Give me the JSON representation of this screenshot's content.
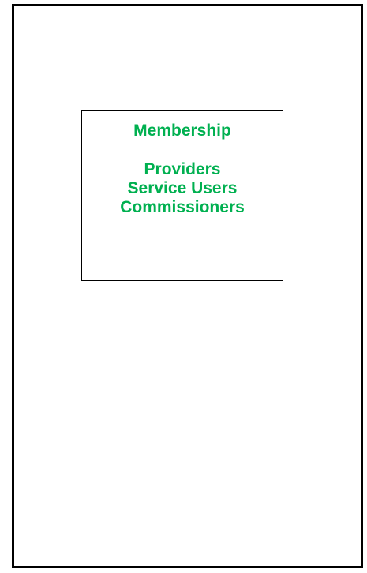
{
  "membership_box": {
    "heading": "Membership",
    "members": [
      "Providers",
      "Service Users",
      "Commissioners"
    ]
  },
  "colors": {
    "text": "#00b050",
    "border": "#000000",
    "background": "#ffffff"
  }
}
